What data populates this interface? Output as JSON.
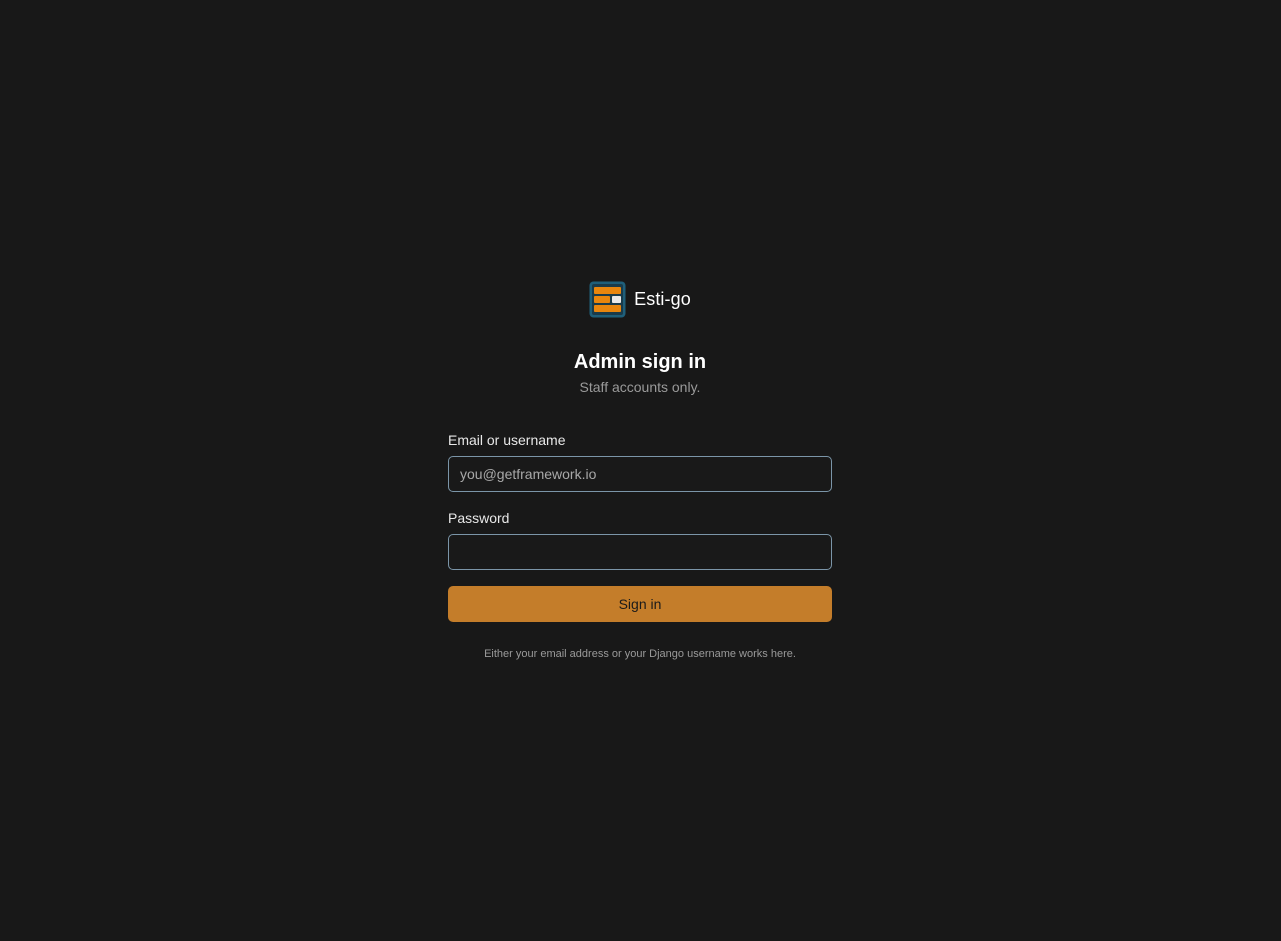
{
  "brand": {
    "name": "Esti-go",
    "logo_icon": "layout-blocks-icon",
    "logo_colors": {
      "frame": "#1f5f7a",
      "bar": "#e8860e",
      "chip": "#e9e9e9"
    }
  },
  "header": {
    "title": "Admin sign in",
    "subtitle": "Staff accounts only."
  },
  "form": {
    "email": {
      "label": "Email or username",
      "value": "",
      "placeholder": "you@getframework.io"
    },
    "password": {
      "label": "Password",
      "value": "",
      "placeholder": ""
    },
    "submit_label": "Sign in"
  },
  "hint": "Either your email address or your Django username works here.",
  "colors": {
    "background": "#181818",
    "accent": "#c47d2a",
    "input_border": "#7b95a8",
    "muted_text": "#9a9a9a"
  }
}
